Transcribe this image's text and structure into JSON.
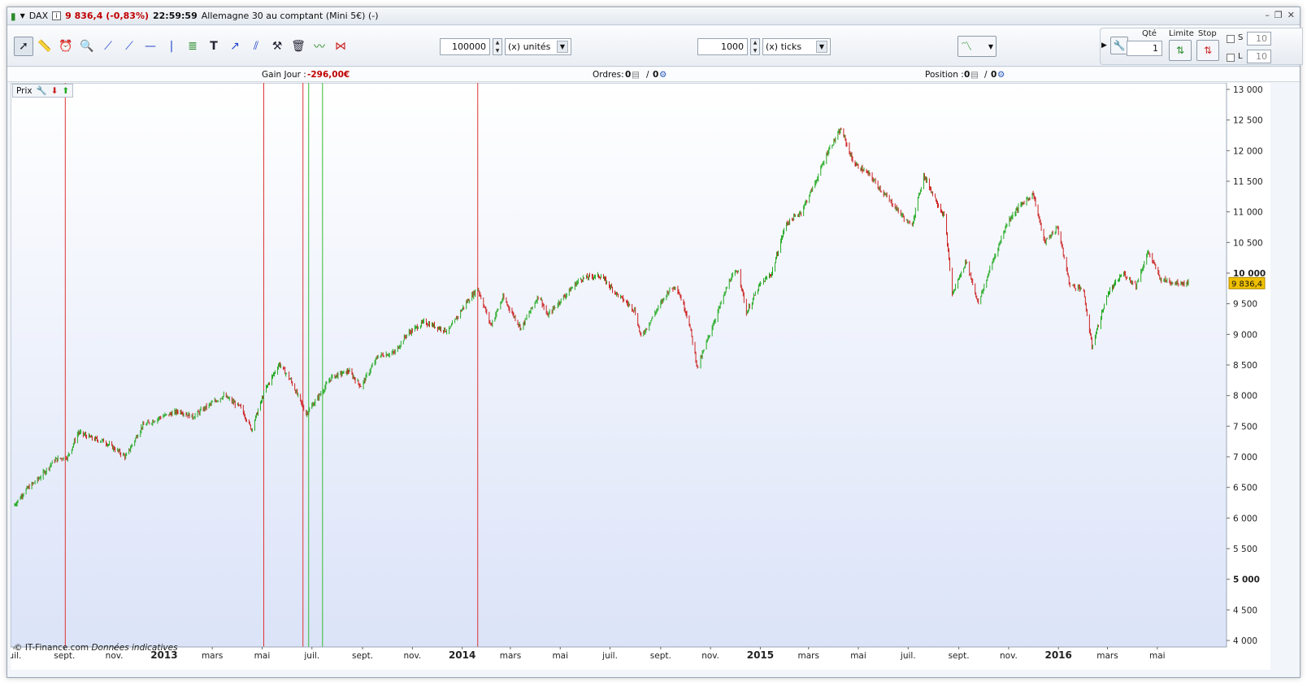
{
  "titlebar": {
    "symbol": "DAX",
    "info_icon": "info-icon",
    "price_change": "9 836,4 (-0,83%)",
    "time": "22:59:59",
    "description": "Allemagne 30 au comptant (Mini 5€) (-)"
  },
  "toolbar": {
    "quantity_value": "100000",
    "quantity_unit": "(x) unités",
    "ticks_value": "1000",
    "ticks_unit": "(x) ticks",
    "qty_label": "Qté",
    "qty_value": "1",
    "limit_label": "Limite",
    "stop_label": "Stop",
    "s_label": "S",
    "l_label": "L",
    "s_value": "10",
    "l_value": "10",
    "icons": [
      "cursor-icon",
      "ruler-icon",
      "alarm-icon",
      "zoom-icon",
      "line-icon",
      "line2-icon",
      "hline-icon",
      "vline-icon",
      "fib-icon",
      "text-icon",
      "arrow-icon",
      "parallel-icon",
      "tools-icon",
      "trash-icon",
      "wave-icon",
      "pattern-icon"
    ]
  },
  "infobar": {
    "gain_label": "Gain Jour :",
    "gain_value": "-296,00€",
    "orders_label": "Ordres:",
    "orders_a": "0",
    "orders_b": "0",
    "position_label": "Position :",
    "position_a": "0",
    "position_b": "0"
  },
  "chart_data": {
    "type": "line",
    "panel_label": "Prix",
    "series_name": "DAX",
    "last_price_label": "9 836,4",
    "colors": {
      "up": "#22aa22",
      "down": "#cc2222",
      "price_tag": "#f0c000"
    },
    "ylim": [
      4000,
      13000
    ],
    "yticks": [
      4000,
      4500,
      5000,
      5500,
      6000,
      6500,
      7000,
      7500,
      8000,
      8500,
      9000,
      9500,
      10000,
      10500,
      11000,
      11500,
      12000,
      12500,
      13000
    ],
    "ytick_labels": [
      "4 000",
      "4 500",
      "5 000",
      "5 500",
      "6 000",
      "6 500",
      "7 000",
      "7 500",
      "8 000",
      "8 500",
      "9 000",
      "9 500",
      "10 000",
      "10 500",
      "11 000",
      "11 500",
      "12 000",
      "12 500",
      "13 000"
    ],
    "bold_yticks": [
      "5 000",
      "10 000"
    ],
    "xlim": [
      "2012-07-01",
      "2016-06-15"
    ],
    "xtick_labels": [
      {
        "date": "2012-07-01",
        "label": "juil."
      },
      {
        "date": "2012-09-01",
        "label": "sept."
      },
      {
        "date": "2012-11-01",
        "label": "nov."
      },
      {
        "date": "2013-01-01",
        "label": "2013",
        "bold": true
      },
      {
        "date": "2013-03-01",
        "label": "mars"
      },
      {
        "date": "2013-05-01",
        "label": "mai"
      },
      {
        "date": "2013-07-01",
        "label": "juil."
      },
      {
        "date": "2013-09-01",
        "label": "sept."
      },
      {
        "date": "2013-11-01",
        "label": "nov."
      },
      {
        "date": "2014-01-01",
        "label": "2014",
        "bold": true
      },
      {
        "date": "2014-03-01",
        "label": "mars"
      },
      {
        "date": "2014-05-01",
        "label": "mai"
      },
      {
        "date": "2014-07-01",
        "label": "juil."
      },
      {
        "date": "2014-09-01",
        "label": "sept."
      },
      {
        "date": "2014-11-01",
        "label": "nov."
      },
      {
        "date": "2015-01-01",
        "label": "2015",
        "bold": true
      },
      {
        "date": "2015-03-01",
        "label": "mars"
      },
      {
        "date": "2015-05-01",
        "label": "mai"
      },
      {
        "date": "2015-07-01",
        "label": "juil."
      },
      {
        "date": "2015-09-01",
        "label": "sept."
      },
      {
        "date": "2015-11-01",
        "label": "nov."
      },
      {
        "date": "2016-01-01",
        "label": "2016",
        "bold": true
      },
      {
        "date": "2016-03-01",
        "label": "mars"
      },
      {
        "date": "2016-05-01",
        "label": "mai"
      }
    ],
    "points": [
      [
        "2012-07-01",
        6200
      ],
      [
        "2012-07-15",
        6450
      ],
      [
        "2012-08-01",
        6650
      ],
      [
        "2012-08-20",
        6950
      ],
      [
        "2012-09-05",
        7000
      ],
      [
        "2012-09-18",
        7400
      ],
      [
        "2012-10-05",
        7300
      ],
      [
        "2012-10-20",
        7250
      ],
      [
        "2012-11-15",
        7000
      ],
      [
        "2012-12-05",
        7500
      ],
      [
        "2012-12-28",
        7650
      ],
      [
        "2013-01-20",
        7750
      ],
      [
        "2013-02-05",
        7650
      ],
      [
        "2013-02-20",
        7800
      ],
      [
        "2013-03-15",
        8000
      ],
      [
        "2013-04-05",
        7800
      ],
      [
        "2013-04-18",
        7450
      ],
      [
        "2013-05-05",
        8100
      ],
      [
        "2013-05-22",
        8520
      ],
      [
        "2013-06-05",
        8250
      ],
      [
        "2013-06-24",
        7700
      ],
      [
        "2013-07-10",
        8000
      ],
      [
        "2013-07-25",
        8300
      ],
      [
        "2013-08-15",
        8400
      ],
      [
        "2013-08-30",
        8150
      ],
      [
        "2013-09-20",
        8650
      ],
      [
        "2013-10-10",
        8700
      ],
      [
        "2013-10-25",
        9000
      ],
      [
        "2013-11-15",
        9200
      ],
      [
        "2013-12-05",
        9100
      ],
      [
        "2013-12-15",
        9050
      ],
      [
        "2014-01-05",
        9500
      ],
      [
        "2014-01-20",
        9750
      ],
      [
        "2014-02-05",
        9150
      ],
      [
        "2014-02-20",
        9600
      ],
      [
        "2014-03-14",
        9100
      ],
      [
        "2014-04-05",
        9650
      ],
      [
        "2014-04-15",
        9300
      ],
      [
        "2014-05-01",
        9550
      ],
      [
        "2014-05-25",
        9900
      ],
      [
        "2014-06-10",
        9950
      ],
      [
        "2014-06-20",
        9950
      ],
      [
        "2014-07-10",
        9650
      ],
      [
        "2014-07-31",
        9400
      ],
      [
        "2014-08-08",
        8950
      ],
      [
        "2014-08-25",
        9350
      ],
      [
        "2014-09-10",
        9700
      ],
      [
        "2014-09-20",
        9800
      ],
      [
        "2014-10-05",
        9250
      ],
      [
        "2014-10-16",
        8450
      ],
      [
        "2014-11-05",
        9200
      ],
      [
        "2014-11-25",
        9900
      ],
      [
        "2014-12-05",
        10050
      ],
      [
        "2014-12-15",
        9350
      ],
      [
        "2014-12-31",
        9800
      ],
      [
        "2015-01-15",
        10000
      ],
      [
        "2015-02-01",
        10800
      ],
      [
        "2015-02-20",
        11000
      ],
      [
        "2015-03-10",
        11500
      ],
      [
        "2015-03-25",
        12000
      ],
      [
        "2015-04-10",
        12350
      ],
      [
        "2015-04-25",
        11800
      ],
      [
        "2015-05-15",
        11600
      ],
      [
        "2015-06-01",
        11300
      ],
      [
        "2015-06-20",
        11000
      ],
      [
        "2015-07-05",
        10750
      ],
      [
        "2015-07-20",
        11600
      ],
      [
        "2015-07-31",
        11300
      ],
      [
        "2015-08-15",
        10900
      ],
      [
        "2015-08-24",
        9650
      ],
      [
        "2015-09-10",
        10200
      ],
      [
        "2015-09-25",
        9500
      ],
      [
        "2015-10-10",
        10100
      ],
      [
        "2015-10-31",
        10850
      ],
      [
        "2015-11-15",
        11100
      ],
      [
        "2015-12-01",
        11300
      ],
      [
        "2015-12-15",
        10500
      ],
      [
        "2015-12-31",
        10750
      ],
      [
        "2016-01-15",
        9800
      ],
      [
        "2016-01-31",
        9750
      ],
      [
        "2016-02-11",
        8800
      ],
      [
        "2016-03-01",
        9650
      ],
      [
        "2016-03-20",
        10000
      ],
      [
        "2016-04-05",
        9800
      ],
      [
        "2016-04-20",
        10350
      ],
      [
        "2016-05-05",
        9900
      ],
      [
        "2016-05-20",
        9850
      ],
      [
        "2016-06-08",
        9836
      ]
    ],
    "trade_markers": [
      {
        "date": "2012-09-02",
        "color": "red"
      },
      {
        "date": "2013-05-03",
        "color": "red"
      },
      {
        "date": "2013-06-20",
        "color": "red"
      },
      {
        "date": "2013-06-27",
        "color": "green"
      },
      {
        "date": "2013-07-14",
        "color": "green"
      },
      {
        "date": "2014-01-20",
        "color": "red"
      }
    ],
    "watermark_source": "© IT-Finance.com",
    "watermark_note": "Données indicatives"
  }
}
